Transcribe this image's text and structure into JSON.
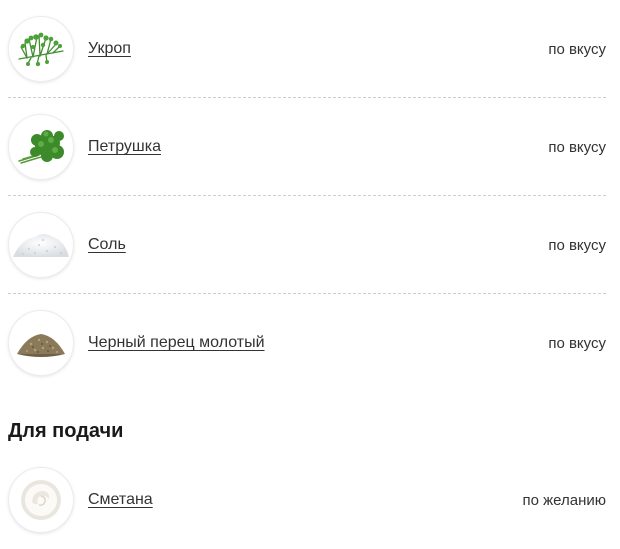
{
  "ingredients": [
    {
      "name": "Укроп",
      "amount": "по вкусу",
      "icon": "dill-icon"
    },
    {
      "name": "Петрушка",
      "amount": "по вкусу",
      "icon": "parsley-icon"
    },
    {
      "name": "Соль",
      "amount": "по вкусу",
      "icon": "salt-icon"
    },
    {
      "name": "Черный перец молотый",
      "amount": "по вкусу",
      "icon": "ground-pepper-icon"
    }
  ],
  "serving": {
    "title": "Для подачи",
    "items": [
      {
        "name": "Сметана",
        "amount": "по желанию",
        "icon": "sour-cream-icon"
      }
    ]
  },
  "colors": {
    "text": "#333333",
    "divider": "#cfcfcf",
    "herb_green": "#3f8f2f"
  }
}
